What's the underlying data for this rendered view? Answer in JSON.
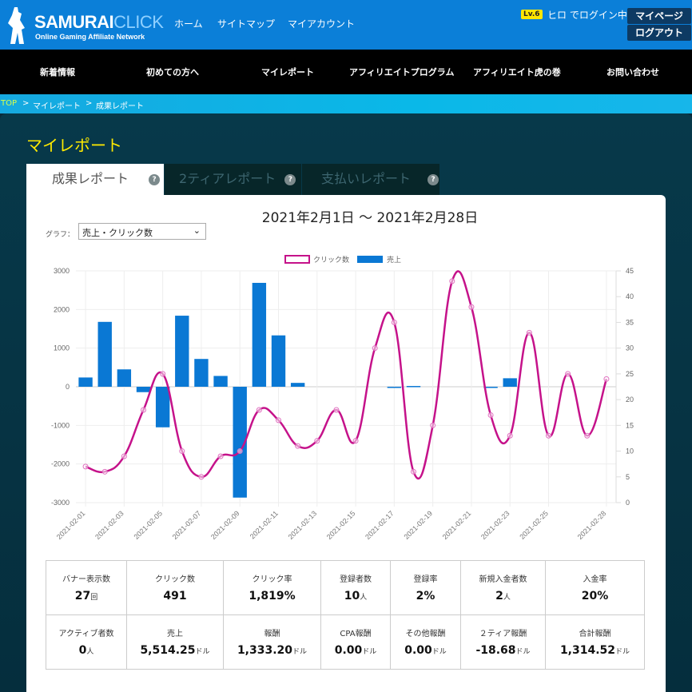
{
  "header": {
    "brand_main": "SAMURAI",
    "brand_accent": "CLICK",
    "tagline": "Online Gaming Affiliate Network",
    "top_links": [
      "ホーム",
      "サイトマップ",
      "マイアカウント"
    ],
    "level": "Lv.6",
    "login_text": "ヒロ でログイン中",
    "mypage": "マイページ",
    "logout": "ログアウト"
  },
  "nav": [
    "新着情報",
    "初めての方へ",
    "マイレポート",
    "アフィリエイトプログラム",
    "アフィリエイト虎の巻",
    "お問い合わせ"
  ],
  "breadcrumb": [
    "TOP",
    ">",
    "マイレポート",
    ">",
    "成果レポート"
  ],
  "page_title": "マイレポート",
  "tabs": [
    {
      "label": "成果レポート",
      "active": true
    },
    {
      "label": "2ティアレポート"
    },
    {
      "label": "支払いレポート"
    }
  ],
  "help_glyph": "?",
  "period": "2021年2月1日 ～ 2021年2月28日",
  "graph_label": "グラフ：",
  "graph_select": "売上・クリック数",
  "colors": {
    "bar": "#0a78d4",
    "line": "#c5128a",
    "title": "#ffea00"
  },
  "chart_data": {
    "type": "bar+line",
    "legend": [
      {
        "name": "クリック数",
        "type": "line"
      },
      {
        "name": "売上",
        "type": "bar"
      }
    ],
    "legend_position": "top",
    "x": [
      "2021-02-01",
      "2021-02-02",
      "2021-02-03",
      "2021-02-04",
      "2021-02-05",
      "2021-02-06",
      "2021-02-07",
      "2021-02-08",
      "2021-02-09",
      "2021-02-10",
      "2021-02-11",
      "2021-02-12",
      "2021-02-13",
      "2021-02-14",
      "2021-02-15",
      "2021-02-16",
      "2021-02-17",
      "2021-02-18",
      "2021-02-19",
      "2021-02-20",
      "2021-02-21",
      "2021-02-22",
      "2021-02-23",
      "2021-02-24",
      "2021-02-25",
      "2021-02-26",
      "2021-02-27",
      "2021-02-28"
    ],
    "x_tick_labels": [
      "2021-02-01",
      "2021-02-03",
      "2021-02-05",
      "2021-02-07",
      "2021-02-09",
      "2021-02-11",
      "2021-02-13",
      "2021-02-15",
      "2021-02-17",
      "2021-02-19",
      "2021-02-21",
      "2021-02-23",
      "2021-02-25",
      "2021-02-28"
    ],
    "series": [
      {
        "name": "売上",
        "axis": "left",
        "values": [
          240,
          1680,
          450,
          -140,
          -1050,
          1840,
          720,
          280,
          -2870,
          2690,
          1330,
          100,
          0,
          0,
          0,
          0,
          -20,
          20,
          0,
          0,
          0,
          -30,
          220,
          0,
          0,
          0,
          0,
          0
        ]
      },
      {
        "name": "クリック数",
        "axis": "right",
        "values": [
          7,
          6,
          9,
          18,
          25,
          10,
          5,
          9,
          10,
          18,
          16,
          11,
          12,
          18,
          12,
          30,
          35,
          6,
          15,
          43,
          38,
          17,
          13,
          33,
          13,
          25,
          13,
          24
        ]
      }
    ],
    "y_left": {
      "range": [
        -3000,
        3000
      ],
      "ticks": [
        3000,
        2000,
        1000,
        0,
        -1000,
        -2000,
        -3000
      ]
    },
    "y_right": {
      "range": [
        0,
        45
      ],
      "ticks": [
        45,
        40,
        35,
        30,
        25,
        20,
        15,
        10,
        5,
        0
      ]
    },
    "grid": true
  },
  "stats": [
    [
      {
        "label": "バナー表示数",
        "value": "27",
        "unit": "回"
      },
      {
        "label": "クリック数",
        "value": "491",
        "unit": ""
      },
      {
        "label": "クリック率",
        "value": "1,819%",
        "unit": ""
      },
      {
        "label": "登録者数",
        "value": "10",
        "unit": "人"
      },
      {
        "label": "登録率",
        "value": "2%",
        "unit": ""
      },
      {
        "label": "新規入金者数",
        "value": "2",
        "unit": "人"
      },
      {
        "label": "入金率",
        "value": "20%",
        "unit": ""
      }
    ],
    [
      {
        "label": "アクティブ者数",
        "value": "0",
        "unit": "人"
      },
      {
        "label": "売上",
        "value": "5,514.25",
        "unit": "ドル"
      },
      {
        "label": "報酬",
        "value": "1,333.20",
        "unit": "ドル"
      },
      {
        "label": "CPA報酬",
        "value": "0.00",
        "unit": "ドル"
      },
      {
        "label": "その他報酬",
        "value": "0.00",
        "unit": "ドル"
      },
      {
        "label": "２ティア報酬",
        "value": "-18.68",
        "unit": "ドル"
      },
      {
        "label": "合計報酬",
        "value": "1,314.52",
        "unit": "ドル"
      }
    ]
  ]
}
